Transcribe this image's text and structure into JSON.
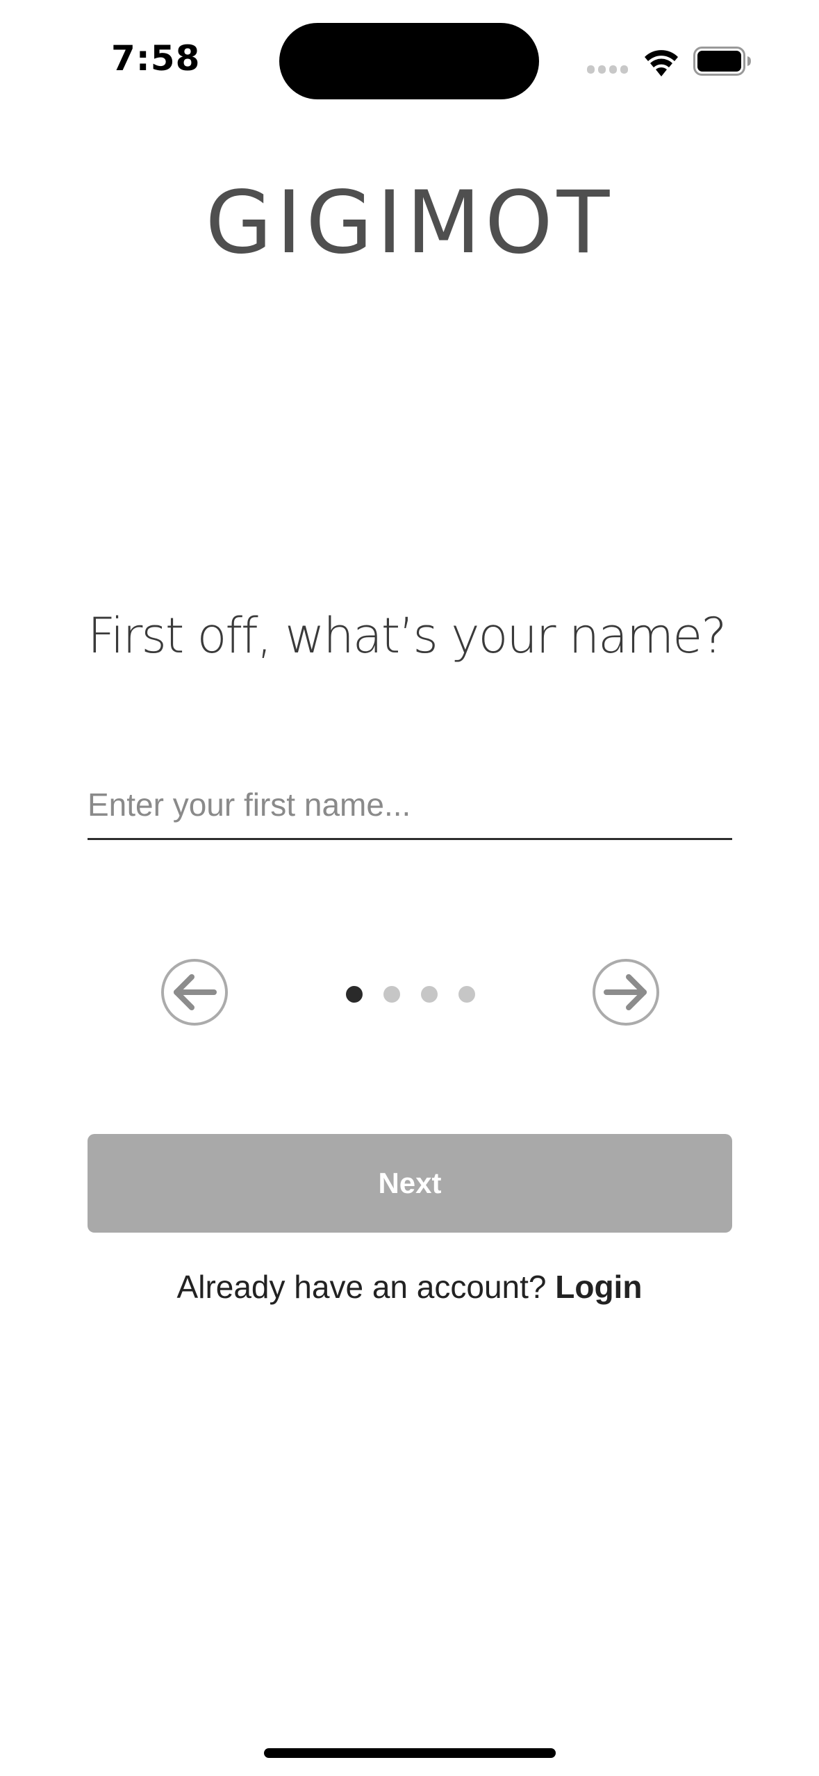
{
  "status_bar": {
    "time": "7:58"
  },
  "app": {
    "logo_text": "GIGIMOT"
  },
  "onboarding": {
    "question": "First off, what’s your name?",
    "first_name": {
      "value": "",
      "placeholder": "Enter your first name..."
    },
    "pager": {
      "total_steps": 4,
      "current_step": 1
    },
    "next_label": "Next"
  },
  "footer": {
    "prompt": "Already have an account?",
    "login_label": "Login"
  },
  "colors": {
    "button_disabled": "#a9a9a9",
    "dot_active": "#2a2a2a",
    "dot_inactive": "#c6c6c6",
    "arrow": "#8c8c8c"
  },
  "icons": {
    "prev": "arrow-left-circle-icon",
    "next": "arrow-right-circle-icon"
  }
}
